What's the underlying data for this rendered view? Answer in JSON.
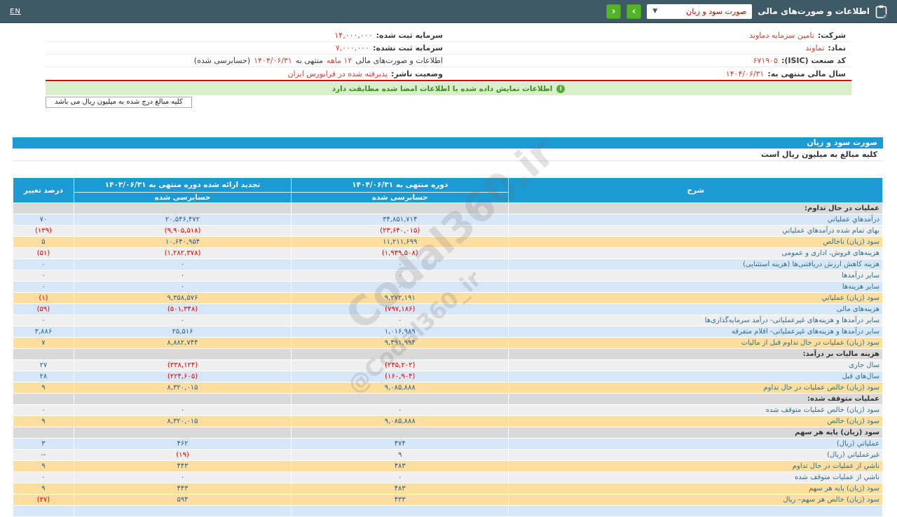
{
  "topbar": {
    "en_label": "EN",
    "title": "اطلاعات و صورت‌های مالی",
    "dropdown_value": "صورت سود و زیان",
    "caret": "▼",
    "nav_next": "›",
    "nav_prev": "‹"
  },
  "info": {
    "company_label": "شرکت:",
    "company_value": "تامین سرمایه دماوند",
    "symbol_label": "نماد:",
    "symbol_value": "تماوند",
    "isic_label": "کد صنعت (ISIC):",
    "isic_value": "۶۷۱۹۰۵",
    "fiscal_label": "سال مالی منتهی به:",
    "fiscal_value": "۱۴۰۴/۰۶/۳۱",
    "registered_capital_label": "سرمایه ثبت شده:",
    "registered_capital_value": "۱۴,۰۰۰,۰۰۰",
    "unregistered_capital_label": "سرمایه ثبت نشده:",
    "unregistered_capital_value": "۷,۰۰۰,۰۰۰",
    "period_text_1": "اطلاعات و صورت‌های مالی",
    "period_red_1": "۱۲ ماهه",
    "period_text_2": "منتهی به",
    "period_red_2": "۱۴۰۴/۰۶/۳۱",
    "period_text_3": "(حسابرسی شده)",
    "status_label": "وضعیت ناشر:",
    "status_value": "پذیرفته شده در فرابورس ایران"
  },
  "notice": {
    "icon": "i",
    "text": "اطلاعات نمایش داده شده با اطلاعات امضا شده مطابقت دارد"
  },
  "unit_box_text": "کلیه مبالغ درج شده به میلیون ریال می باشد",
  "statement": {
    "title": "صورت سود و زیان",
    "unit_note": "کلیه مبالغ به میلیون ریال است"
  },
  "table": {
    "col_desc": "شرح",
    "col_current": "دوره منتهی به ۱۴۰۴/۰۶/۳۱",
    "col_current_sub": "حسابرسی شده",
    "col_restated": "تجدید ارائه شده دوره منتهی به ۱۴۰۳/۰۶/۳۱",
    "col_restated_sub": "حسابرسی شده",
    "col_change": "درصد تغییر",
    "rows": [
      {
        "type": "section",
        "label": "عملیات در حال تداوم:",
        "current": "",
        "restated": "",
        "change": ""
      },
      {
        "type": "blue",
        "label": "درآمدهاي عملياتي",
        "current": "۳۴,۸۵۱,۷۱۴",
        "restated": "۲۰,۵۴۶,۴۷۲",
        "change": "۷۰"
      },
      {
        "type": "gray",
        "label": "بهای تمام شده درآمدهاي عملياتي",
        "current": "(۲۳,۶۴۰,۰۱۵)",
        "restated": "(۹,۹۰۵,۵۱۸)",
        "change": "(۱۳۹)"
      },
      {
        "type": "yellow",
        "label": "سود (زیان) ناخالص",
        "current": "۱۱,۲۱۱,۶۹۹",
        "restated": "۱۰,۶۴۰,۹۵۴",
        "change": "۵"
      },
      {
        "type": "gray",
        "label": "هزینه‌های فروش، اداری و عمومی",
        "current": "(۱,۹۳۹,۵۰۸)",
        "restated": "(۱,۲۸۲,۳۷۸)",
        "change": "(۵۱)"
      },
      {
        "type": "blue",
        "label": "هزینه کاهش ارزش دریافتنی‌ها (هزینه استثنایی)",
        "current": "۰",
        "restated": "۰",
        "change": "۰"
      },
      {
        "type": "gray",
        "label": "سایر درآمدها",
        "current": "۰",
        "restated": "۰",
        "change": "۰"
      },
      {
        "type": "blue",
        "label": "سایر هزینه‌ها",
        "current": "۰",
        "restated": "۰",
        "change": "۰"
      },
      {
        "type": "yellow",
        "label": "سود (زیان) عملیاتي",
        "current": "۹,۲۷۲,۱۹۱",
        "restated": "۹,۳۵۸,۵۷۶",
        "change": "(۱)"
      },
      {
        "type": "blue",
        "label": "هزینه‌های مالی",
        "current": "(۷۹۷,۱۸۶)",
        "restated": "(۵۰۱,۳۴۸)",
        "change": "(۵۹)"
      },
      {
        "type": "gray",
        "label": "سایر درآمدها و هزینه‌های غیرعملیاتی- درآمد سرمایه‌گذاری‌ها",
        "current": "۰",
        "restated": "۰",
        "change": "۰"
      },
      {
        "type": "blue",
        "label": "سایر درآمدها و هزینه‌های غیرعملیاتی- اقلام متفرقه",
        "current": "۱,۰۱۶,۹۸۹",
        "restated": "۲۵,۵۱۶",
        "change": "۳,۸۸۶"
      },
      {
        "type": "yellow",
        "label": "سود (زیان) عملیات در حال تداوم قبل از مالیات",
        "current": "۹,۴۹۱,۹۹۴",
        "restated": "۸,۸۸۲,۷۴۴",
        "change": "۷"
      },
      {
        "type": "section",
        "label": "هزینه مالیات بر درآمد:",
        "current": "",
        "restated": "",
        "change": ""
      },
      {
        "type": "gray",
        "label": "سال جاری",
        "current": "(۲۴۵,۲۰۲)",
        "restated": "(۳۳۸,۱۲۴)",
        "change": "۲۷"
      },
      {
        "type": "blue",
        "label": "سال‌های قبل",
        "current": "(۱۶۰,۹۰۴)",
        "restated": "(۲۲۴,۶۰۵)",
        "change": "۲۸"
      },
      {
        "type": "yellow",
        "label": "سود (زیان) خالص عملیات در حال تداوم",
        "current": "۹,۰۸۵,۸۸۸",
        "restated": "۸,۳۲۰,۰۱۵",
        "change": "۹"
      },
      {
        "type": "section",
        "label": "عملیات متوقف شده:",
        "current": "",
        "restated": "",
        "change": ""
      },
      {
        "type": "gray",
        "label": "سود (زیان) خالص عملیات متوقف شده",
        "current": "۰",
        "restated": "۰",
        "change": "۰"
      },
      {
        "type": "yellow",
        "label": "سود (زیان) خالص",
        "current": "۹,۰۸۵,۸۸۸",
        "restated": "۸,۳۲۰,۰۱۵",
        "change": "۹"
      },
      {
        "type": "section",
        "label": "سود (زیان) پایه هر سهم",
        "current": "",
        "restated": "",
        "change": ""
      },
      {
        "type": "blue",
        "label": "عملیاتي (ریال)",
        "current": "۴۷۴",
        "restated": "۴۶۲",
        "change": "۳"
      },
      {
        "type": "gray",
        "label": "غیرعملیاتي (ریال)",
        "current": "۹",
        "restated": "(۱۹)",
        "change": "--"
      },
      {
        "type": "yellow",
        "label": "ناشي از عملیات در حال تداوم",
        "current": "۴۸۳",
        "restated": "۴۴۳",
        "change": "۹"
      },
      {
        "type": "gray",
        "label": "ناشي از عملیات متوقف شده",
        "current": "۰",
        "restated": "۰",
        "change": "۰"
      },
      {
        "type": "yellow",
        "label": "سود (زیان) پایه هر سهم",
        "current": "۴۸۳",
        "restated": "۴۴۳",
        "change": "۹"
      },
      {
        "type": "yellow",
        "label": "سود (زیان) خالص هر سهم– ریال",
        "current": "۴۳۳",
        "restated": "۵۹۴",
        "change": "(۲۷)"
      },
      {
        "type": "partial",
        "label": "",
        "current": "",
        "restated": "",
        "change": ""
      }
    ]
  },
  "watermark": {
    "main": "Codal360.ir",
    "handle": "@Codal360_ir"
  },
  "colors": {
    "topbar": "#3d5a66",
    "accent_blue": "#1b9ad4",
    "green_button": "#54b427",
    "notice_bg": "#d9efca",
    "notice_text": "#3d8b22",
    "value_red": "#cb4335",
    "negative_red": "#e60000",
    "row_yellow": "#fcdf9f",
    "row_blue": "#d7e7f7",
    "row_gray": "#efefef",
    "row_section": "#d9d9d9"
  }
}
